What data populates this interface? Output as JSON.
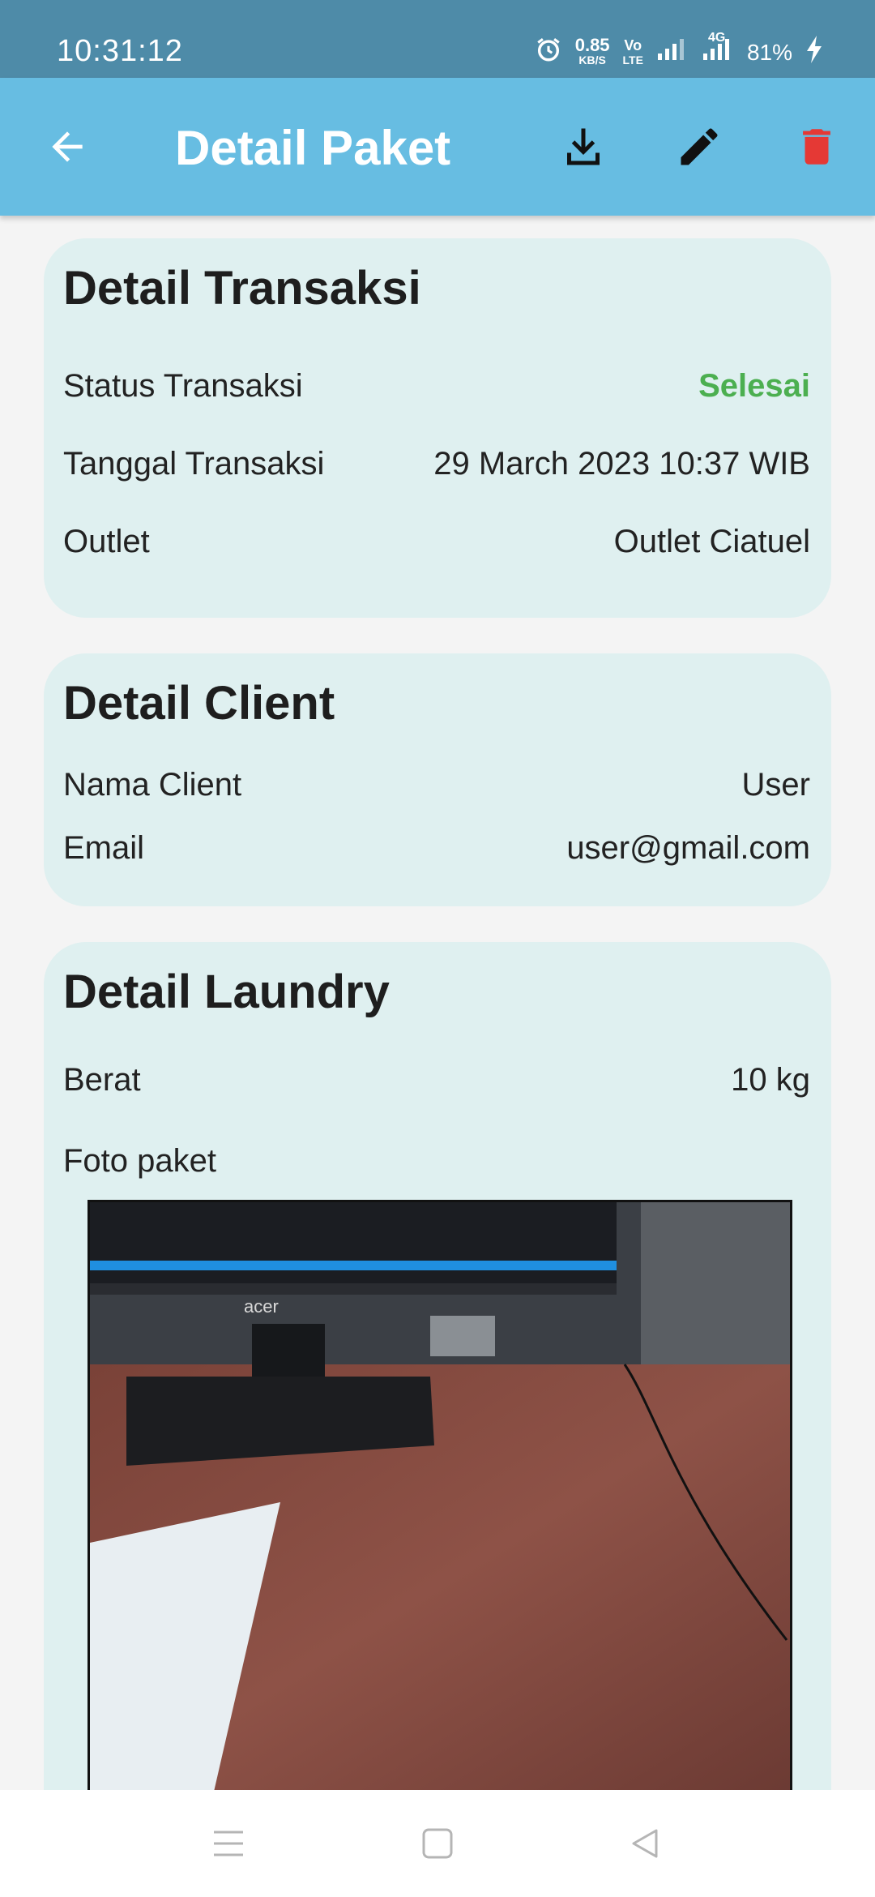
{
  "status_bar": {
    "time": "10:31:12",
    "net_speed_value": "0.85",
    "net_speed_unit": "KB/S",
    "volte_top": "Vo",
    "volte_bottom": "LTE",
    "network": "4G",
    "battery": "81%"
  },
  "app_bar": {
    "title": "Detail Paket",
    "icons": [
      "back-arrow-icon",
      "download-icon",
      "edit-icon",
      "delete-icon"
    ],
    "delete_color": "#e53935"
  },
  "transaction": {
    "title": "Detail Transaksi",
    "status_label": "Status Transaksi",
    "status_value": "Selesai",
    "date_label": "Tanggal Transaksi",
    "date_value": "29 March 2023 10:37 WIB",
    "outlet_label": "Outlet",
    "outlet_value": "Outlet Ciatuel"
  },
  "client": {
    "title": "Detail Client",
    "name_label": "Nama Client",
    "name_value": "User",
    "email_label": "Email",
    "email_value": "user@gmail.com"
  },
  "laundry": {
    "title": "Detail Laundry",
    "weight_label": "Berat",
    "weight_value": "10 kg",
    "photo_label": "Foto paket",
    "photo_brand": "acer"
  },
  "nav_bar": {
    "icons": [
      "menu-icon",
      "home-icon",
      "back-icon"
    ]
  },
  "colors": {
    "status_bar": "#4e8ba8",
    "app_bar": "#67bde2",
    "card": "#dff0f0",
    "success": "#4caf50"
  }
}
